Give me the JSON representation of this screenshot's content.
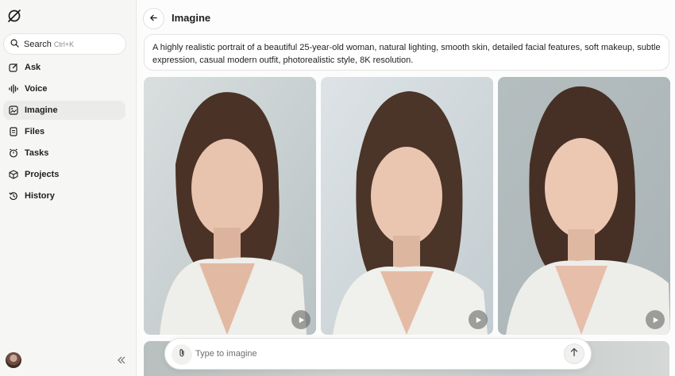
{
  "sidebar": {
    "logo_icon": "grok-logo-icon",
    "search": {
      "label": "Search",
      "shortcut": "Ctrl+K",
      "icon": "search-icon"
    },
    "items": [
      {
        "label": "Ask",
        "icon": "edit-icon",
        "active": false
      },
      {
        "label": "Voice",
        "icon": "waveform-icon",
        "active": false
      },
      {
        "label": "Imagine",
        "icon": "image-icon",
        "active": true
      },
      {
        "label": "Files",
        "icon": "file-icon",
        "active": false
      },
      {
        "label": "Tasks",
        "icon": "tasks-icon",
        "active": false
      },
      {
        "label": "Projects",
        "icon": "cube-icon",
        "active": false
      },
      {
        "label": "History",
        "icon": "history-icon",
        "active": false
      }
    ],
    "collapse_icon": "double-chevron-left-icon"
  },
  "header": {
    "title": "Imagine",
    "back_icon": "arrow-left-icon"
  },
  "prompt": {
    "text": "A highly realistic portrait of a beautiful 25-year-old woman, natural lighting, smooth skin, detailed facial features, soft makeup, subtle expression, casual modern outfit, photorealistic style, 8K resolution."
  },
  "images": [
    {
      "name": "generated-image-1",
      "play_icon": "play-icon"
    },
    {
      "name": "generated-image-2",
      "play_icon": "play-icon"
    },
    {
      "name": "generated-image-3",
      "play_icon": "play-icon"
    }
  ],
  "composer": {
    "placeholder": "Type to imagine",
    "attach_icon": "paperclip-icon",
    "send_icon": "arrow-up-icon"
  },
  "colors": {
    "accent_bg": "#ebebe9",
    "sidebar_bg": "#f6f6f5",
    "image_bg": "#cdd6da"
  }
}
